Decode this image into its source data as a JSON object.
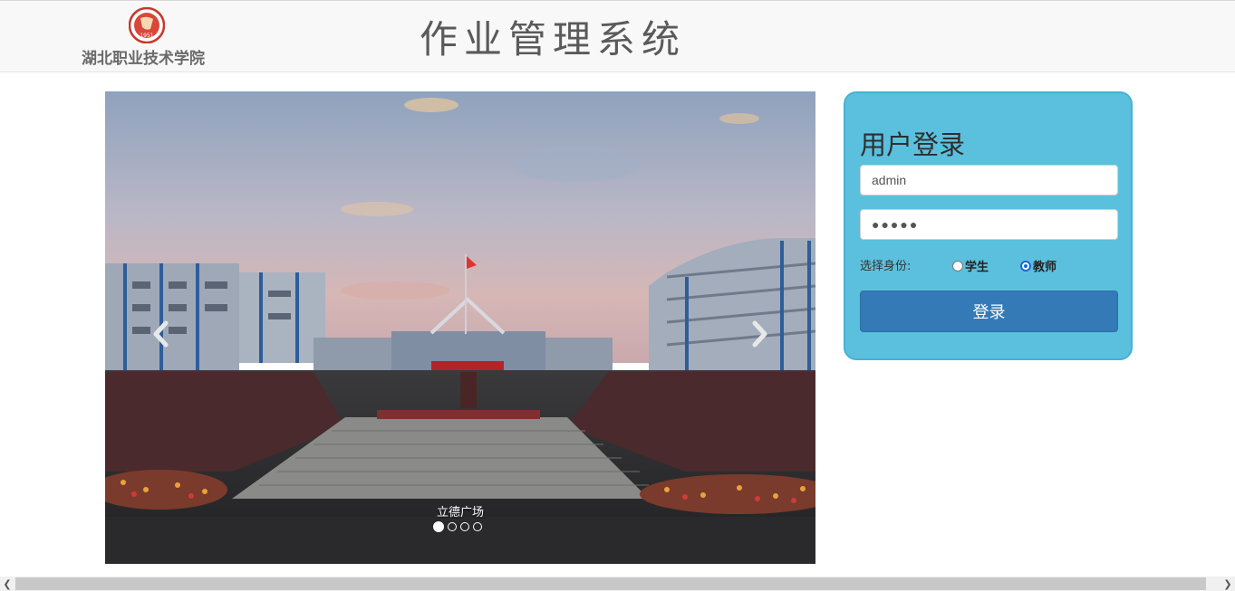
{
  "header": {
    "school_name": "湖北职业技术学院",
    "system_title": "作业管理系统",
    "emblem_year": "1951"
  },
  "carousel": {
    "caption": "立德广场",
    "slide_count": 4,
    "active_index": 0
  },
  "login": {
    "title": "用户登录",
    "username_value": "admin",
    "password_value": "●●●●●",
    "role_label": "选择身份:",
    "roles": [
      {
        "label": "学生",
        "checked": false
      },
      {
        "label": "教师",
        "checked": true
      }
    ],
    "submit_label": "登录"
  },
  "colors": {
    "panel_bg": "#5bc0de",
    "button_bg": "#337ab7",
    "radio_checked": "#1a66d2"
  }
}
